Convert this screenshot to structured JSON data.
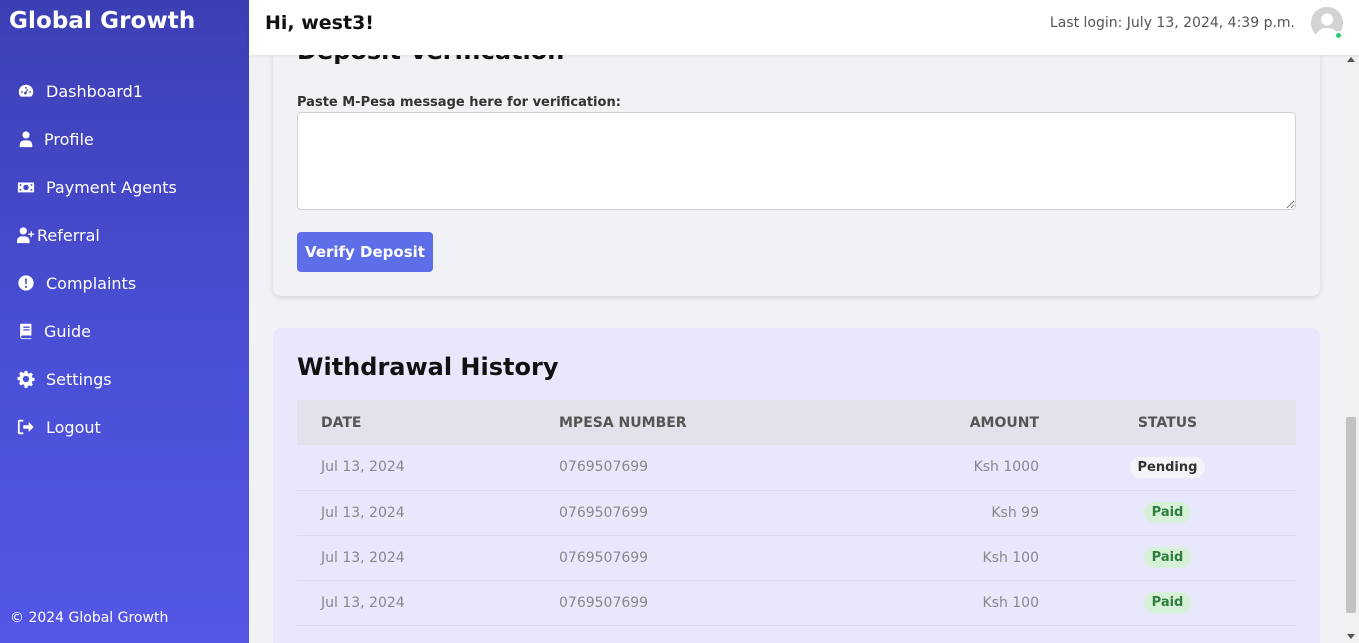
{
  "brand": "Global Growth",
  "sidebar": {
    "items": [
      {
        "label": "Dashboard1",
        "icon": "gauge-icon"
      },
      {
        "label": "Profile",
        "icon": "user-icon"
      },
      {
        "label": "Payment Agents",
        "icon": "money-icon"
      },
      {
        "label": "Referral",
        "icon": "user-plus-icon"
      },
      {
        "label": "Complaints",
        "icon": "exclamation-circle-icon"
      },
      {
        "label": "Guide",
        "icon": "book-icon"
      },
      {
        "label": "Settings",
        "icon": "gear-icon"
      },
      {
        "label": "Logout",
        "icon": "sign-out-icon"
      }
    ],
    "footer": "© 2024 Global Growth"
  },
  "header": {
    "greeting": "Hi, west3!",
    "last_login": "Last login: July 13, 2024, 4:39 p.m."
  },
  "deposit": {
    "title": "Deposit Verification",
    "label": "Paste M-Pesa message here for verification:",
    "textarea_value": "",
    "button": "Verify Deposit"
  },
  "withdrawals": {
    "title": "Withdrawal History",
    "columns": [
      "DATE",
      "MPESA NUMBER",
      "AMOUNT",
      "STATUS"
    ],
    "rows": [
      {
        "date": "Jul 13, 2024",
        "number": "0769507699",
        "amount": "Ksh 1000",
        "status": "Pending"
      },
      {
        "date": "Jul 13, 2024",
        "number": "0769507699",
        "amount": "Ksh 99",
        "status": "Paid"
      },
      {
        "date": "Jul 13, 2024",
        "number": "0769507699",
        "amount": "Ksh 100",
        "status": "Paid"
      },
      {
        "date": "Jul 13, 2024",
        "number": "0769507699",
        "amount": "Ksh 100",
        "status": "Paid"
      }
    ]
  },
  "colors": {
    "sidebar_top": "#3c3fb3",
    "sidebar_bottom": "#5457e6",
    "button": "#5e6ee8",
    "withdraw_card": "#e9e7fb",
    "paid_bg": "#d7f1d9",
    "paid_text": "#2f7d3e",
    "online": "#2ecc71"
  }
}
